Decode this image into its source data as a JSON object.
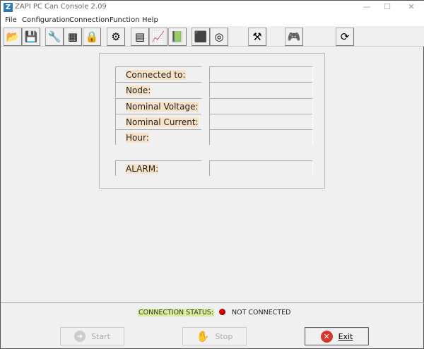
{
  "window": {
    "title": "ZAPI PC Can Console 2.09"
  },
  "menu": [
    "File",
    "Configuration",
    "Connection",
    "Function",
    "Help"
  ],
  "toolbar": [
    {
      "name": "open",
      "icon": "📂"
    },
    {
      "name": "save",
      "icon": "💾"
    },
    {
      "name": "tools",
      "icon": "🔧"
    },
    {
      "name": "board",
      "icon": "▦"
    },
    {
      "name": "lock",
      "icon": "🔒"
    },
    {
      "name": "network",
      "icon": "⚙"
    },
    {
      "name": "list",
      "icon": "▤"
    },
    {
      "name": "graph",
      "icon": "📈"
    },
    {
      "name": "notebook",
      "icon": "📗"
    },
    {
      "name": "motor",
      "icon": "⬛"
    },
    {
      "name": "connector",
      "icon": "◎"
    },
    {
      "name": "settings",
      "icon": "⚒"
    },
    {
      "name": "gamepad",
      "icon": "🎮"
    },
    {
      "name": "refresh",
      "icon": "⟳"
    }
  ],
  "info": {
    "labels": [
      "Connected to:",
      "Node:",
      "Nominal Voltage:",
      "Nominal Current:",
      "Hour:"
    ],
    "values": [
      "",
      "",
      "",
      "",
      ""
    ],
    "alarm_label": "ALARM:",
    "alarm_value": ""
  },
  "status": {
    "label": "CONNECTION STATUS:",
    "value": "NOT CONNECTED",
    "led_color": "#dd0000"
  },
  "buttons": {
    "start": "Start",
    "stop": "Stop",
    "exit": "Exit"
  }
}
